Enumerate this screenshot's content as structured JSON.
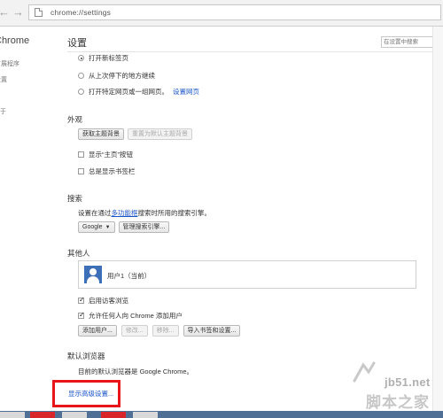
{
  "browser": {
    "back_icon": "arrow-left-icon",
    "forward_icon": "arrow-right-icon",
    "url": "chrome://settings"
  },
  "sidebar": {
    "title": "Chrome",
    "items": [
      "扩展程序",
      "设置",
      "关于"
    ]
  },
  "header": {
    "title": "设置",
    "search_placeholder": "在设置中搜索"
  },
  "startup": {
    "options": [
      {
        "label": "打开新标签页",
        "selected": true
      },
      {
        "label": "从上次停下的地方继续",
        "selected": false
      },
      {
        "label": "打开特定网页或一组网页。",
        "selected": false,
        "link": "设置网页"
      }
    ]
  },
  "appearance": {
    "title": "外观",
    "get_themes": "获取主题背景",
    "reset_theme": "重置为默认主题背景",
    "show_home": "显示“主页”按钮",
    "show_bookmarks": "总是显示书签栏"
  },
  "search": {
    "title": "搜索",
    "desc_prefix": "设置在通过",
    "desc_link": "多功能框",
    "desc_suffix": "搜索时所用的搜索引擎。",
    "engine": "Google",
    "manage": "管理搜索引擎..."
  },
  "people": {
    "title": "其他人",
    "user": "用户1（当前）",
    "guest": "启用访客浏览",
    "allow_add": "允许任何人向 Chrome 添加用户",
    "buttons": {
      "add": "添加用户...",
      "edit": "修改...",
      "remove": "移除...",
      "import": "导入书签和设置..."
    }
  },
  "default_browser": {
    "title": "默认浏览器",
    "text": "目前的默认浏览器是 Google Chrome。"
  },
  "advanced_link": "显示高级设置...",
  "watermark": {
    "url": "jb51.net",
    "name": "脚本之家"
  },
  "colors": {
    "highlight": "#e8161b",
    "link": "#1a55c8",
    "avatar": "#3d6fb8"
  }
}
